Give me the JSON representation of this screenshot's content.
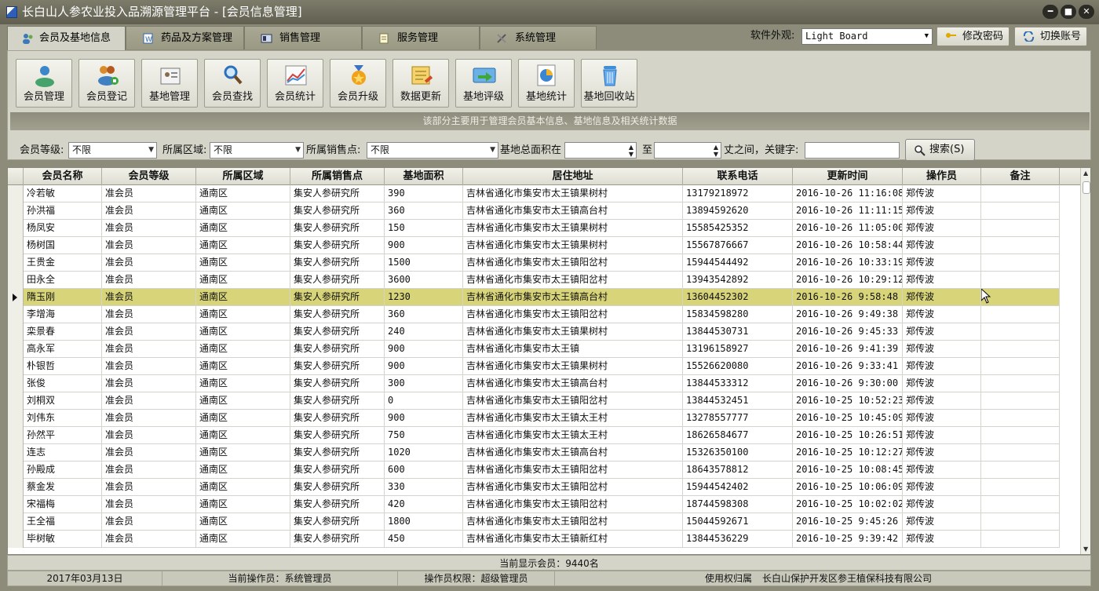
{
  "window": {
    "title": "长白山人参农业投入品溯源管理平台 - [会员信息管理]",
    "min": "━",
    "max": "■",
    "close": "✕"
  },
  "tabs": [
    {
      "label": "会员及基地信息",
      "active": true
    },
    {
      "label": "药品及方案管理"
    },
    {
      "label": "销售管理"
    },
    {
      "label": "服务管理"
    },
    {
      "label": "系统管理"
    }
  ],
  "topright": {
    "skin_label": "软件外观:",
    "skin_value": "Light Board",
    "change_password": "修改密码",
    "switch_account": "切换账号"
  },
  "ribbon": {
    "buttons": [
      {
        "label": "会员管理",
        "icon": "members-icon"
      },
      {
        "label": "会员登记",
        "icon": "register-member-icon"
      },
      {
        "label": "基地管理",
        "icon": "base-manage-icon"
      },
      {
        "label": "会员查找",
        "icon": "search-icon"
      },
      {
        "label": "会员统计",
        "icon": "statistics-icon"
      },
      {
        "label": "会员升级",
        "icon": "upgrade-medal-icon"
      },
      {
        "label": "数据更新",
        "icon": "data-update-icon"
      },
      {
        "label": "基地评级",
        "icon": "rating-icon"
      },
      {
        "label": "基地统计",
        "icon": "pie-chart-icon"
      },
      {
        "label": "基地回收站",
        "icon": "recycle-bin-icon"
      }
    ],
    "banner": "该部分主要用于管理会员基本信息、基地信息及相关统计数据"
  },
  "filters": {
    "level_label": "会员等级:",
    "level_value": "不限",
    "region_label": "所属区域:",
    "region_value": "不限",
    "outlet_label": "所属销售点:",
    "outlet_value": "不限",
    "area_label": "基地总面积在",
    "to_label": "至",
    "unit_keyword_label": "丈之间，关键字:",
    "search_button": "搜索(S)"
  },
  "table": {
    "columns": [
      "会员名称",
      "会员等级",
      "所属区域",
      "所属销售点",
      "基地面积",
      "居住地址",
      "联系电话",
      "更新时间",
      "操作员",
      "备注"
    ],
    "rows": [
      [
        "冷若敏",
        "准会员",
        "通南区",
        "集安人参研究所",
        "390",
        "吉林省通化市集安市太王镇果树村",
        "13179218972",
        "2016-10-26 11:16:08",
        "郑传波",
        ""
      ],
      [
        "孙洪福",
        "准会员",
        "通南区",
        "集安人参研究所",
        "360",
        "吉林省通化市集安市太王镇高台村",
        "13894592620",
        "2016-10-26 11:11:15",
        "郑传波",
        ""
      ],
      [
        "杨凤安",
        "准会员",
        "通南区",
        "集安人参研究所",
        "150",
        "吉林省通化市集安市太王镇果树村",
        "15585425352",
        "2016-10-26 11:05:00",
        "郑传波",
        ""
      ],
      [
        "杨树国",
        "准会员",
        "通南区",
        "集安人参研究所",
        "900",
        "吉林省通化市集安市太王镇果树村",
        "15567876667",
        "2016-10-26 10:58:44",
        "郑传波",
        ""
      ],
      [
        "王贵金",
        "准会员",
        "通南区",
        "集安人参研究所",
        "1500",
        "吉林省通化市集安市太王镇阳岔村",
        "15944544492",
        "2016-10-26 10:33:19",
        "郑传波",
        ""
      ],
      [
        "田永全",
        "准会员",
        "通南区",
        "集安人参研究所",
        "3600",
        "吉林省通化市集安市太王镇阳岔村",
        "13943542892",
        "2016-10-26 10:29:12",
        "郑传波",
        ""
      ],
      [
        "隋玉刚",
        "准会员",
        "通南区",
        "集安人参研究所",
        "1230",
        "吉林省通化市集安市太王镇高台村",
        "13604452302",
        "2016-10-26 9:58:48",
        "郑传波",
        ""
      ],
      [
        "李增海",
        "准会员",
        "通南区",
        "集安人参研究所",
        "360",
        "吉林省通化市集安市太王镇阳岔村",
        "15834598280",
        "2016-10-26 9:49:38",
        "郑传波",
        ""
      ],
      [
        "栾景春",
        "准会员",
        "通南区",
        "集安人参研究所",
        "240",
        "吉林省通化市集安市太王镇果树村",
        "13844530731",
        "2016-10-26 9:45:33",
        "郑传波",
        ""
      ],
      [
        "高永军",
        "准会员",
        "通南区",
        "集安人参研究所",
        "900",
        "吉林省通化市集安市太王镇",
        "13196158927",
        "2016-10-26 9:41:39",
        "郑传波",
        ""
      ],
      [
        "朴银哲",
        "准会员",
        "通南区",
        "集安人参研究所",
        "900",
        "吉林省通化市集安市太王镇果树村",
        "15526620080",
        "2016-10-26 9:33:41",
        "郑传波",
        ""
      ],
      [
        "张俊",
        "准会员",
        "通南区",
        "集安人参研究所",
        "300",
        "吉林省通化市集安市太王镇高台村",
        "13844533312",
        "2016-10-26 9:30:00",
        "郑传波",
        ""
      ],
      [
        "刘桐双",
        "准会员",
        "通南区",
        "集安人参研究所",
        "0",
        "吉林省通化市集安市太王镇阳岔村",
        "13844532451",
        "2016-10-25 10:52:23",
        "郑传波",
        ""
      ],
      [
        "刘伟东",
        "准会员",
        "通南区",
        "集安人参研究所",
        "900",
        "吉林省通化市集安市太王镇太王村",
        "13278557777",
        "2016-10-25 10:45:09",
        "郑传波",
        ""
      ],
      [
        "孙然平",
        "准会员",
        "通南区",
        "集安人参研究所",
        "750",
        "吉林省通化市集安市太王镇太王村",
        "18626584677",
        "2016-10-25 10:26:51",
        "郑传波",
        ""
      ],
      [
        "连志",
        "准会员",
        "通南区",
        "集安人参研究所",
        "1020",
        "吉林省通化市集安市太王镇高台村",
        "15326350100",
        "2016-10-25 10:12:27",
        "郑传波",
        ""
      ],
      [
        "孙殿成",
        "准会员",
        "通南区",
        "集安人参研究所",
        "600",
        "吉林省通化市集安市太王镇阳岔村",
        "18643578812",
        "2016-10-25 10:08:45",
        "郑传波",
        ""
      ],
      [
        "蔡金发",
        "准会员",
        "通南区",
        "集安人参研究所",
        "330",
        "吉林省通化市集安市太王镇阳岔村",
        "15944542402",
        "2016-10-25 10:06:09",
        "郑传波",
        ""
      ],
      [
        "宋福梅",
        "准会员",
        "通南区",
        "集安人参研究所",
        "420",
        "吉林省通化市集安市太王镇阳岔村",
        "18744598308",
        "2016-10-25 10:02:02",
        "郑传波",
        ""
      ],
      [
        "王全福",
        "准会员",
        "通南区",
        "集安人参研究所",
        "1800",
        "吉林省通化市集安市太王镇阳岔村",
        "15044592671",
        "2016-10-25 9:45:26",
        "郑传波",
        ""
      ],
      [
        "毕树敏",
        "准会员",
        "通南区",
        "集安人参研究所",
        "450",
        "吉林省通化市集安市太王镇新红村",
        "13844536229",
        "2016-10-25 9:39:42",
        "郑传波",
        ""
      ]
    ],
    "selected_row": 6
  },
  "footer": {
    "count": "当前显示会员：9440名"
  },
  "statusbar": {
    "date": "2017年03月13日",
    "operator": "当前操作员：系统管理员",
    "permission": "操作员权限：超级管理员",
    "rights_label": "使用权归属",
    "owner": "长白山保护开发区参王植保科技有限公司"
  },
  "colors": {
    "selected_row": "#d8d47a",
    "chrome": "#8d8c7a",
    "panel": "#d4d4c8"
  }
}
